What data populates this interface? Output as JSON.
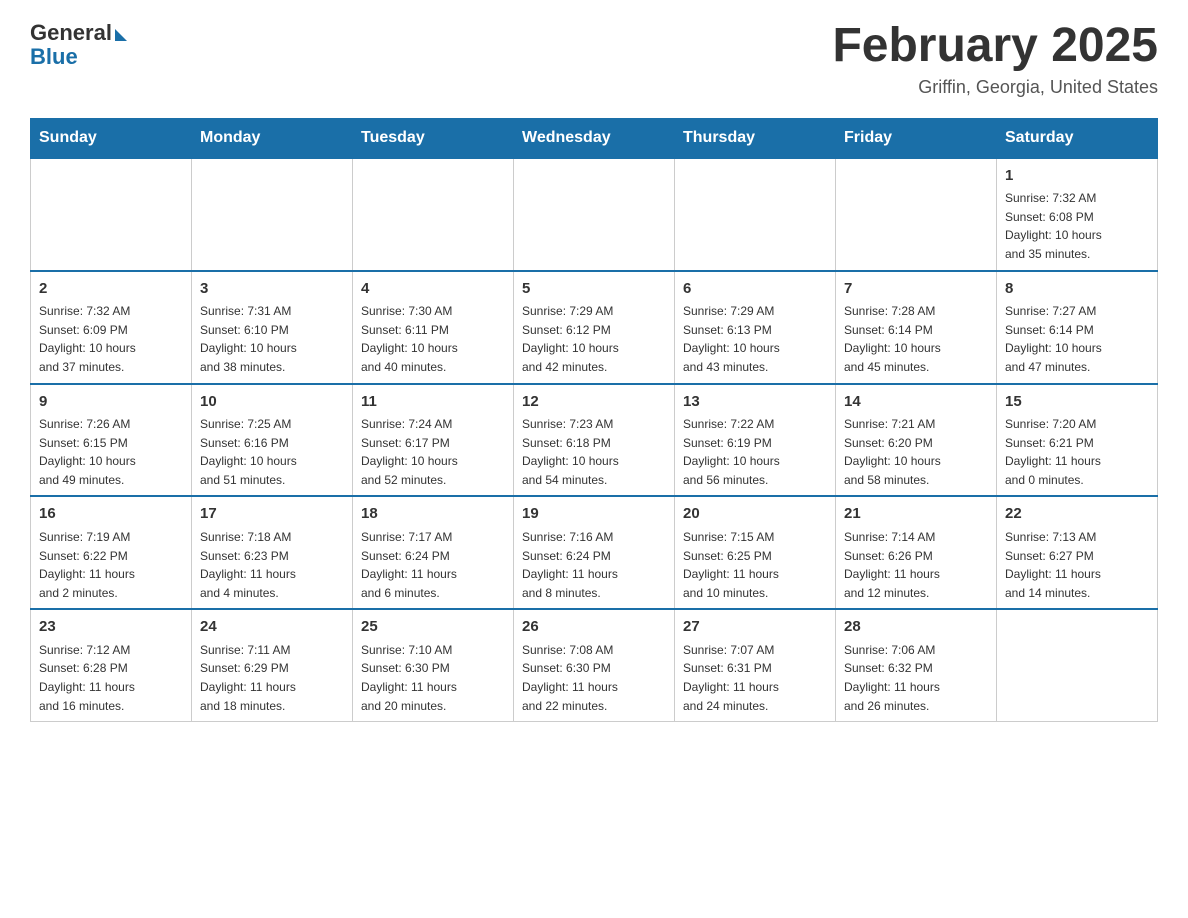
{
  "header": {
    "logo_general": "General",
    "logo_blue": "Blue",
    "month_title": "February 2025",
    "location": "Griffin, Georgia, United States"
  },
  "days_of_week": [
    "Sunday",
    "Monday",
    "Tuesday",
    "Wednesday",
    "Thursday",
    "Friday",
    "Saturday"
  ],
  "weeks": [
    {
      "days": [
        {
          "number": "",
          "info": ""
        },
        {
          "number": "",
          "info": ""
        },
        {
          "number": "",
          "info": ""
        },
        {
          "number": "",
          "info": ""
        },
        {
          "number": "",
          "info": ""
        },
        {
          "number": "",
          "info": ""
        },
        {
          "number": "1",
          "info": "Sunrise: 7:32 AM\nSunset: 6:08 PM\nDaylight: 10 hours\nand 35 minutes."
        }
      ]
    },
    {
      "days": [
        {
          "number": "2",
          "info": "Sunrise: 7:32 AM\nSunset: 6:09 PM\nDaylight: 10 hours\nand 37 minutes."
        },
        {
          "number": "3",
          "info": "Sunrise: 7:31 AM\nSunset: 6:10 PM\nDaylight: 10 hours\nand 38 minutes."
        },
        {
          "number": "4",
          "info": "Sunrise: 7:30 AM\nSunset: 6:11 PM\nDaylight: 10 hours\nand 40 minutes."
        },
        {
          "number": "5",
          "info": "Sunrise: 7:29 AM\nSunset: 6:12 PM\nDaylight: 10 hours\nand 42 minutes."
        },
        {
          "number": "6",
          "info": "Sunrise: 7:29 AM\nSunset: 6:13 PM\nDaylight: 10 hours\nand 43 minutes."
        },
        {
          "number": "7",
          "info": "Sunrise: 7:28 AM\nSunset: 6:14 PM\nDaylight: 10 hours\nand 45 minutes."
        },
        {
          "number": "8",
          "info": "Sunrise: 7:27 AM\nSunset: 6:14 PM\nDaylight: 10 hours\nand 47 minutes."
        }
      ]
    },
    {
      "days": [
        {
          "number": "9",
          "info": "Sunrise: 7:26 AM\nSunset: 6:15 PM\nDaylight: 10 hours\nand 49 minutes."
        },
        {
          "number": "10",
          "info": "Sunrise: 7:25 AM\nSunset: 6:16 PM\nDaylight: 10 hours\nand 51 minutes."
        },
        {
          "number": "11",
          "info": "Sunrise: 7:24 AM\nSunset: 6:17 PM\nDaylight: 10 hours\nand 52 minutes."
        },
        {
          "number": "12",
          "info": "Sunrise: 7:23 AM\nSunset: 6:18 PM\nDaylight: 10 hours\nand 54 minutes."
        },
        {
          "number": "13",
          "info": "Sunrise: 7:22 AM\nSunset: 6:19 PM\nDaylight: 10 hours\nand 56 minutes."
        },
        {
          "number": "14",
          "info": "Sunrise: 7:21 AM\nSunset: 6:20 PM\nDaylight: 10 hours\nand 58 minutes."
        },
        {
          "number": "15",
          "info": "Sunrise: 7:20 AM\nSunset: 6:21 PM\nDaylight: 11 hours\nand 0 minutes."
        }
      ]
    },
    {
      "days": [
        {
          "number": "16",
          "info": "Sunrise: 7:19 AM\nSunset: 6:22 PM\nDaylight: 11 hours\nand 2 minutes."
        },
        {
          "number": "17",
          "info": "Sunrise: 7:18 AM\nSunset: 6:23 PM\nDaylight: 11 hours\nand 4 minutes."
        },
        {
          "number": "18",
          "info": "Sunrise: 7:17 AM\nSunset: 6:24 PM\nDaylight: 11 hours\nand 6 minutes."
        },
        {
          "number": "19",
          "info": "Sunrise: 7:16 AM\nSunset: 6:24 PM\nDaylight: 11 hours\nand 8 minutes."
        },
        {
          "number": "20",
          "info": "Sunrise: 7:15 AM\nSunset: 6:25 PM\nDaylight: 11 hours\nand 10 minutes."
        },
        {
          "number": "21",
          "info": "Sunrise: 7:14 AM\nSunset: 6:26 PM\nDaylight: 11 hours\nand 12 minutes."
        },
        {
          "number": "22",
          "info": "Sunrise: 7:13 AM\nSunset: 6:27 PM\nDaylight: 11 hours\nand 14 minutes."
        }
      ]
    },
    {
      "days": [
        {
          "number": "23",
          "info": "Sunrise: 7:12 AM\nSunset: 6:28 PM\nDaylight: 11 hours\nand 16 minutes."
        },
        {
          "number": "24",
          "info": "Sunrise: 7:11 AM\nSunset: 6:29 PM\nDaylight: 11 hours\nand 18 minutes."
        },
        {
          "number": "25",
          "info": "Sunrise: 7:10 AM\nSunset: 6:30 PM\nDaylight: 11 hours\nand 20 minutes."
        },
        {
          "number": "26",
          "info": "Sunrise: 7:08 AM\nSunset: 6:30 PM\nDaylight: 11 hours\nand 22 minutes."
        },
        {
          "number": "27",
          "info": "Sunrise: 7:07 AM\nSunset: 6:31 PM\nDaylight: 11 hours\nand 24 minutes."
        },
        {
          "number": "28",
          "info": "Sunrise: 7:06 AM\nSunset: 6:32 PM\nDaylight: 11 hours\nand 26 minutes."
        },
        {
          "number": "",
          "info": ""
        }
      ]
    }
  ]
}
